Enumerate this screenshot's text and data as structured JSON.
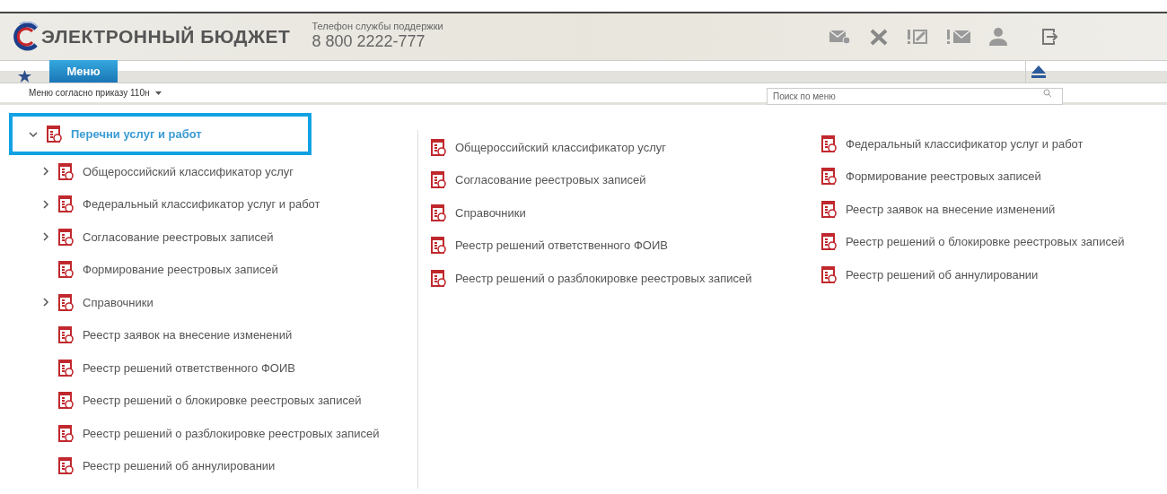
{
  "header": {
    "logo_text": "ЭЛЕКТРОННЫЙ БЮДЖЕТ",
    "support_label": "Телефон службы поддержки",
    "support_phone": "8 800 2222-777"
  },
  "tabs": [
    {
      "kind": "favorites",
      "selected": false
    },
    {
      "kind": "text",
      "label": "Меню",
      "selected": true
    }
  ],
  "menu_selector": {
    "label": "Меню согласно приказу 110н"
  },
  "search": {
    "placeholder": "Поиск по меню"
  },
  "tree": {
    "label": "Перечни услуг и работ",
    "expanded": true,
    "selected": true,
    "children": [
      {
        "label": "Общероссийский классификатор услуг",
        "kind": "branch",
        "expanded": false
      },
      {
        "label": "Федеральный классификатор услуг и работ",
        "kind": "branch",
        "expanded": false
      },
      {
        "label": "Согласование реестровых записей",
        "kind": "branch",
        "expanded": false
      },
      {
        "label": "Формирование реестровых записей",
        "kind": "leaf"
      },
      {
        "label": "Справочники",
        "kind": "branch",
        "expanded": false
      },
      {
        "label": "Реестр заявок на внесение изменений",
        "kind": "leaf"
      },
      {
        "label": "Реестр решений ответственного ФОИВ",
        "kind": "leaf"
      },
      {
        "label": "Реестр решений о блокировке реестровых записей",
        "kind": "leaf"
      },
      {
        "label": "Реестр решений о разблокировке реестровых записей",
        "kind": "leaf"
      },
      {
        "label": "Реестр решений об аннулировании",
        "kind": "leaf"
      }
    ]
  },
  "links": [
    [
      "Общероссийский классификатор услуг",
      "Согласование реестровых записей",
      "Справочники",
      "Реестр решений ответственного ФОИВ",
      "Реестр решений о разблокировке реестровых записей"
    ],
    [
      "Федеральный классификатор услуг и работ",
      "Формирование реестровых записей",
      "Реестр заявок на внесение изменений",
      "Реестр решений о блокировке реестровых записей",
      "Реестр решений об аннулировании"
    ]
  ]
}
